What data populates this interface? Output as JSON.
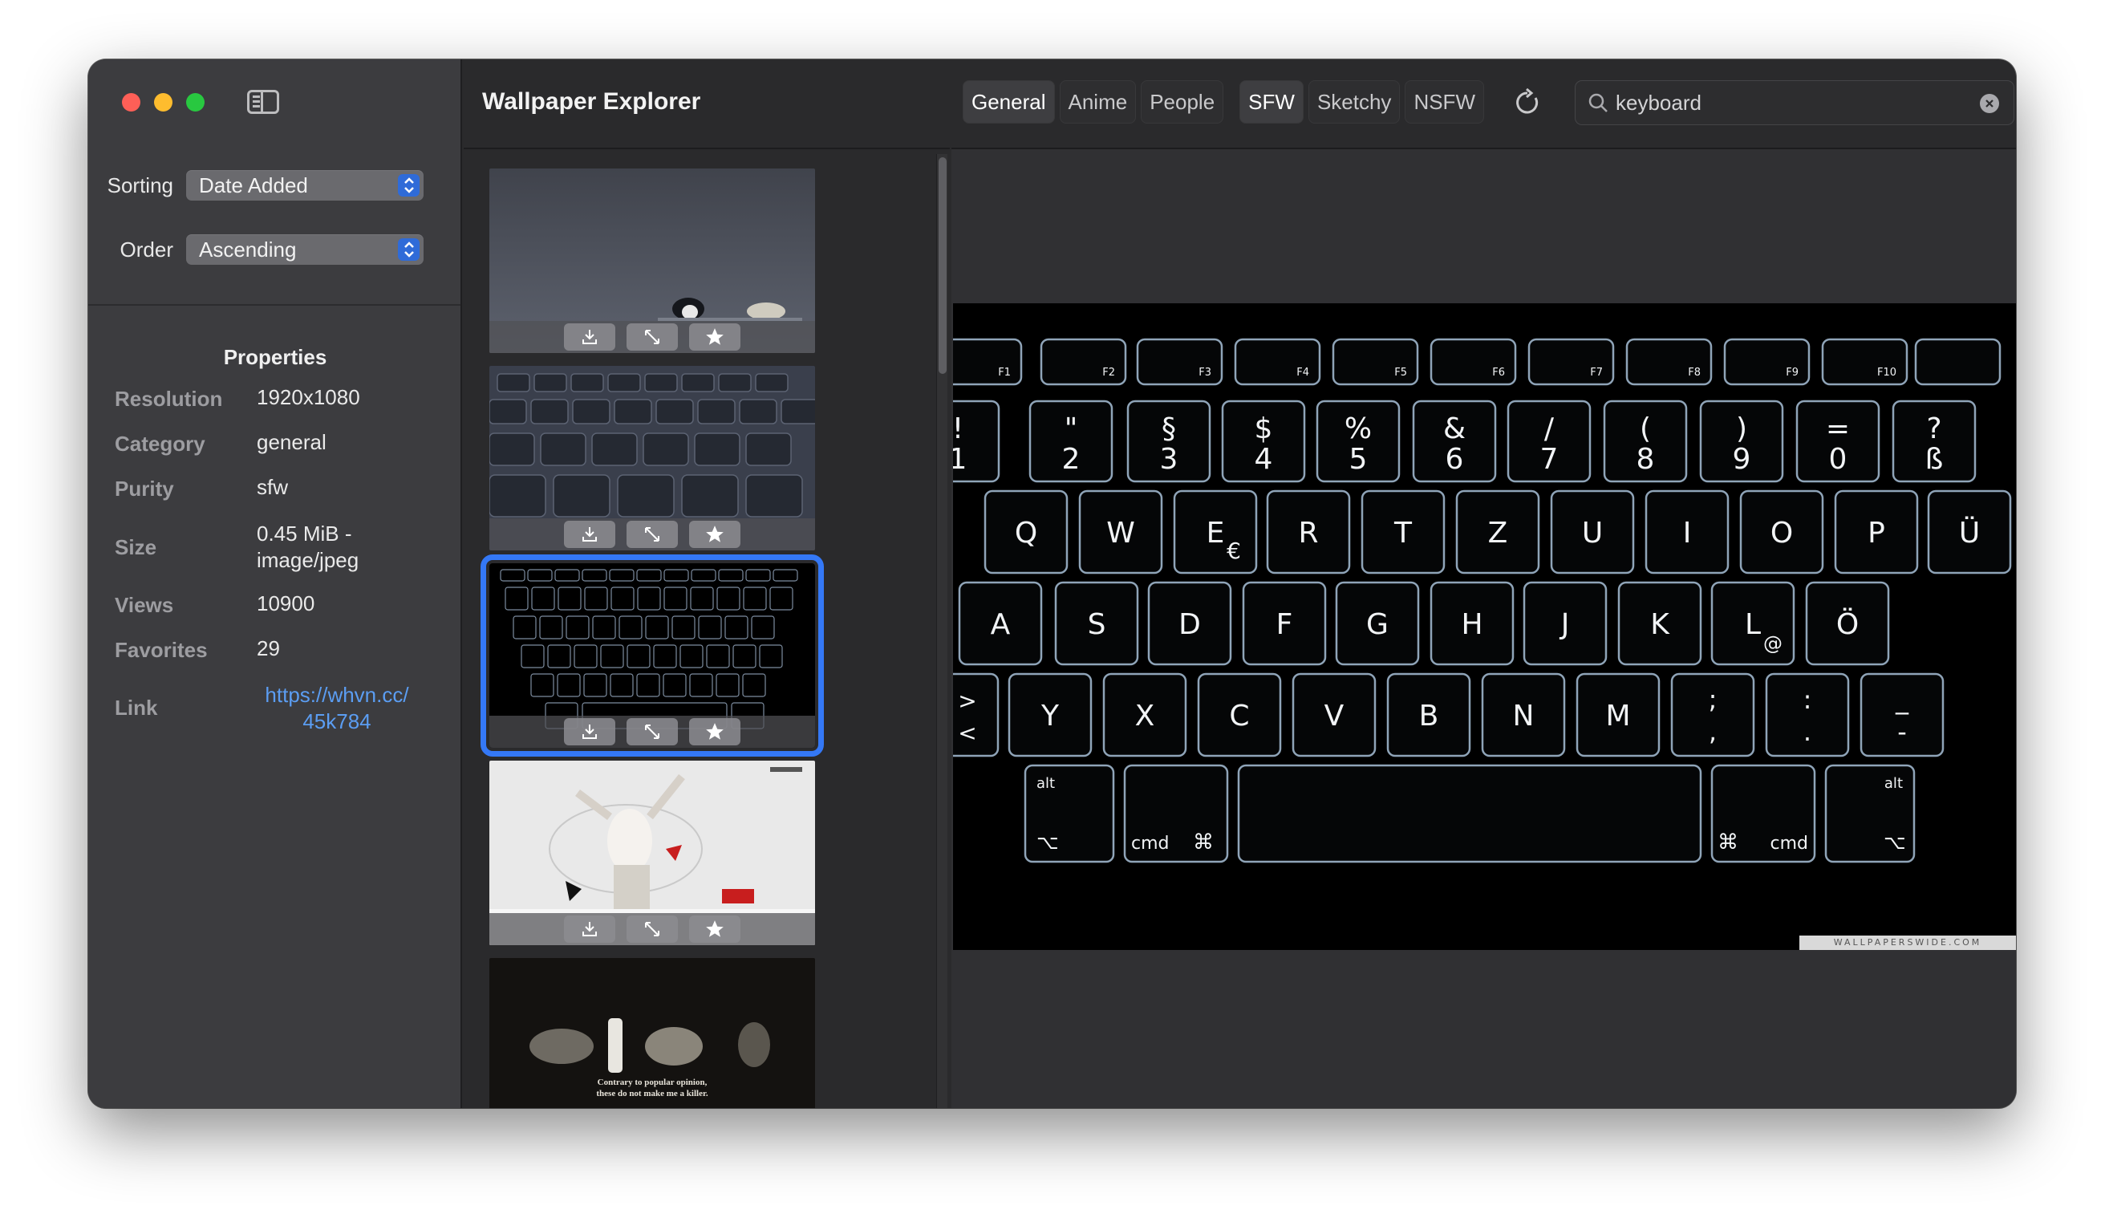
{
  "toolbar": {
    "title": "Wallpaper Explorer",
    "tabs": [
      {
        "label": "General",
        "active": true
      },
      {
        "label": "Anime",
        "active": false
      },
      {
        "label": "People",
        "active": false
      },
      {
        "label": "SFW",
        "active": true
      },
      {
        "label": "Sketchy",
        "active": false
      },
      {
        "label": "NSFW",
        "active": false
      }
    ],
    "refresh_icon": "refresh-icon"
  },
  "search": {
    "value": "keyboard",
    "placeholder": "Search"
  },
  "filters": {
    "sorting_label": "Sorting",
    "sorting_value": "Date Added",
    "order_label": "Order",
    "order_value": "Ascending"
  },
  "properties": {
    "title": "Properties",
    "rows": [
      {
        "key": "Resolution",
        "value": "1920x1080"
      },
      {
        "key": "Category",
        "value": "general"
      },
      {
        "key": "Purity",
        "value": "sfw"
      },
      {
        "key": "Size",
        "value": "0.45 MiB -\nimage/jpeg"
      },
      {
        "key": "Views",
        "value": "10900"
      },
      {
        "key": "Favorites",
        "value": "29"
      },
      {
        "key": "Link",
        "value": "https://whvn.cc/\n45k784"
      }
    ]
  },
  "thumbnails": {
    "selected_index": 2,
    "items": [
      "penguins",
      "keyboard-closeup",
      "keyboard-backlit",
      "dancer",
      "controllers"
    ],
    "controllers_caption_1": "Contrary to popular opinion,",
    "controllers_caption_2": "these do not make me a killer."
  },
  "preview": {
    "watermark": "WALLPAPERSWIDE.COM",
    "fkeys": [
      "F1",
      "F2",
      "F3",
      "F4",
      "F5",
      "F6",
      "F7",
      "F8",
      "F9",
      "F10"
    ],
    "number_row": [
      [
        "!",
        "1"
      ],
      [
        "\"",
        "2"
      ],
      [
        "§",
        "3"
      ],
      [
        "$",
        "4"
      ],
      [
        "%",
        "5"
      ],
      [
        "&",
        "6"
      ],
      [
        "/",
        "7"
      ],
      [
        "(",
        "8"
      ],
      [
        ")",
        "9"
      ],
      [
        "=",
        "0"
      ],
      [
        "?",
        "ß"
      ]
    ],
    "qwerty_row": [
      "Q",
      "W",
      "E",
      "R",
      "T",
      "Z",
      "U",
      "I",
      "O",
      "P",
      "Ü"
    ],
    "home_row": [
      "A",
      "S",
      "D",
      "F",
      "G",
      "H",
      "J",
      "K",
      "L",
      "Ö"
    ],
    "bottom_row": [
      "Y",
      "X",
      "C",
      "V",
      "B",
      "N",
      "M"
    ],
    "punct_row": [
      [
        ";",
        ","
      ],
      [
        ":",
        "."
      ],
      [
        "_",
        "-"
      ]
    ],
    "euro": "€",
    "at": "@",
    "gt_lt": [
      ">",
      "<"
    ],
    "mod_left_alt": "alt",
    "mod_left_cmd": "cmd",
    "mod_right_cmd": "cmd",
    "mod_right_alt": "alt",
    "cmd_symbol": "⌘",
    "opt_symbol": "⌥"
  }
}
